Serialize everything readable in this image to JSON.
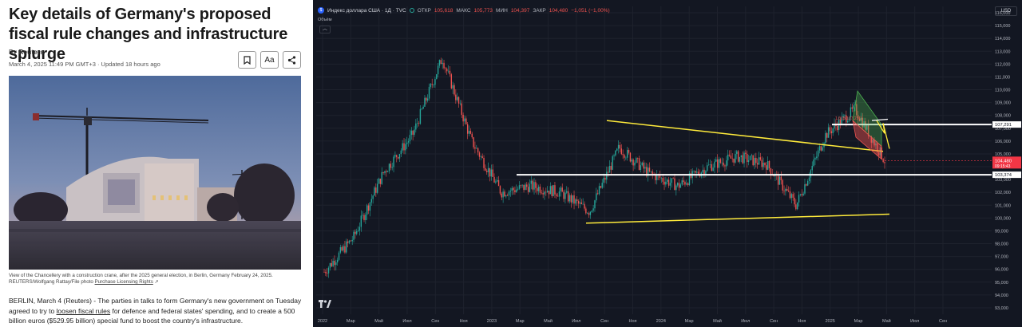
{
  "article": {
    "headline": "Key details of Germany's proposed fiscal rule changes and infrastructure splurge",
    "by_prefix": "By",
    "author": "Reuters",
    "dateline": "March 4, 2025 11:49 PM GMT+3 · Updated 18 hours ago",
    "tools": {
      "bookmark_icon": "bookmark-icon",
      "font_size_label": "Aa",
      "share_icon": "share-icon"
    },
    "caption_line1": "View of the Chancellery with a construction crane, after the 2025 general election, in Berlin, Germany February 24, 2025.",
    "caption_credit": "REUTERS/Wolfgang Rattay/File photo",
    "caption_link": "Purchase Licensing Rights",
    "body_intro": "BERLIN, March 4 (Reuters) - The parties in talks to form Germany's new government on Tuesday agreed to try to ",
    "body_link": "loosen fiscal rules",
    "body_rest": " for defence and federal states' spending, and to create a 500 billion euros ($529.95 billion) special fund to boost the country's infrastructure."
  },
  "chart": {
    "symbol_title": "Индекс доллара США · 1Д · TVC",
    "open_label": "ОТКР",
    "open_value": "105,618",
    "high_label": "МАКС",
    "high_value": "105,773",
    "low_label": "МИН",
    "low_value": "104,397",
    "close_label": "ЗАКР",
    "close_value": "104,480",
    "change": "−1,051 (−1,00%)",
    "volume_label": "Объём",
    "currency": "USD",
    "fib_label": "1,618(107,291)",
    "price_ticks": [
      "116,000",
      "115,000",
      "114,000",
      "113,000",
      "112,000",
      "111,000",
      "110,000",
      "109,000",
      "108,000",
      "107,000",
      "106,000",
      "105,000",
      "104,000",
      "103,000",
      "102,000",
      "101,000",
      "100,000",
      "99,000",
      "98,000",
      "97,000",
      "96,000",
      "95,000",
      "94,000",
      "93,000"
    ],
    "price_markers": [
      {
        "label": "107,291",
        "price": 107.291
      },
      {
        "label": "104,480",
        "sub": "09:15:43",
        "price": 104.48,
        "color": "#f23645"
      },
      {
        "label": "103,374",
        "price": 103.374
      }
    ],
    "time_ticks": [
      "2022",
      "Мар",
      "Май",
      "Июл",
      "Сен",
      "Ноя",
      "2023",
      "Мар",
      "Май",
      "Июл",
      "Сен",
      "Ноя",
      "2024",
      "Мар",
      "Май",
      "Июл",
      "Сен",
      "Ноя",
      "2025",
      "Мар",
      "Май",
      "Июл",
      "Сен"
    ],
    "colors": {
      "up": "#26a69a",
      "down": "#ef5350",
      "trend": "#ffeb3b",
      "level": "#ffffff",
      "bg": "#131722"
    }
  },
  "chart_data": {
    "type": "candlestick",
    "title": "Индекс доллара США · 1Д · TVC",
    "y_unit": "USD index",
    "ylim": [
      92.5,
      116.5
    ],
    "x": [
      "2022-01",
      "2022-03",
      "2022-05",
      "2022-07",
      "2022-09",
      "2022-11",
      "2023-01",
      "2023-03",
      "2023-05",
      "2023-07",
      "2023-09",
      "2023-11",
      "2024-01",
      "2024-03",
      "2024-05",
      "2024-07",
      "2024-09",
      "2024-11",
      "2025-01",
      "2025-03"
    ],
    "approx_close": [
      95.8,
      98.5,
      103.5,
      106.5,
      112.5,
      106.0,
      102.0,
      102.5,
      102.0,
      100.5,
      105.5,
      103.5,
      102.5,
      104.0,
      104.8,
      104.2,
      101.0,
      106.5,
      108.5,
      104.48
    ],
    "horizontal_levels": [
      107.291,
      103.374
    ],
    "last_price": 104.48
  }
}
